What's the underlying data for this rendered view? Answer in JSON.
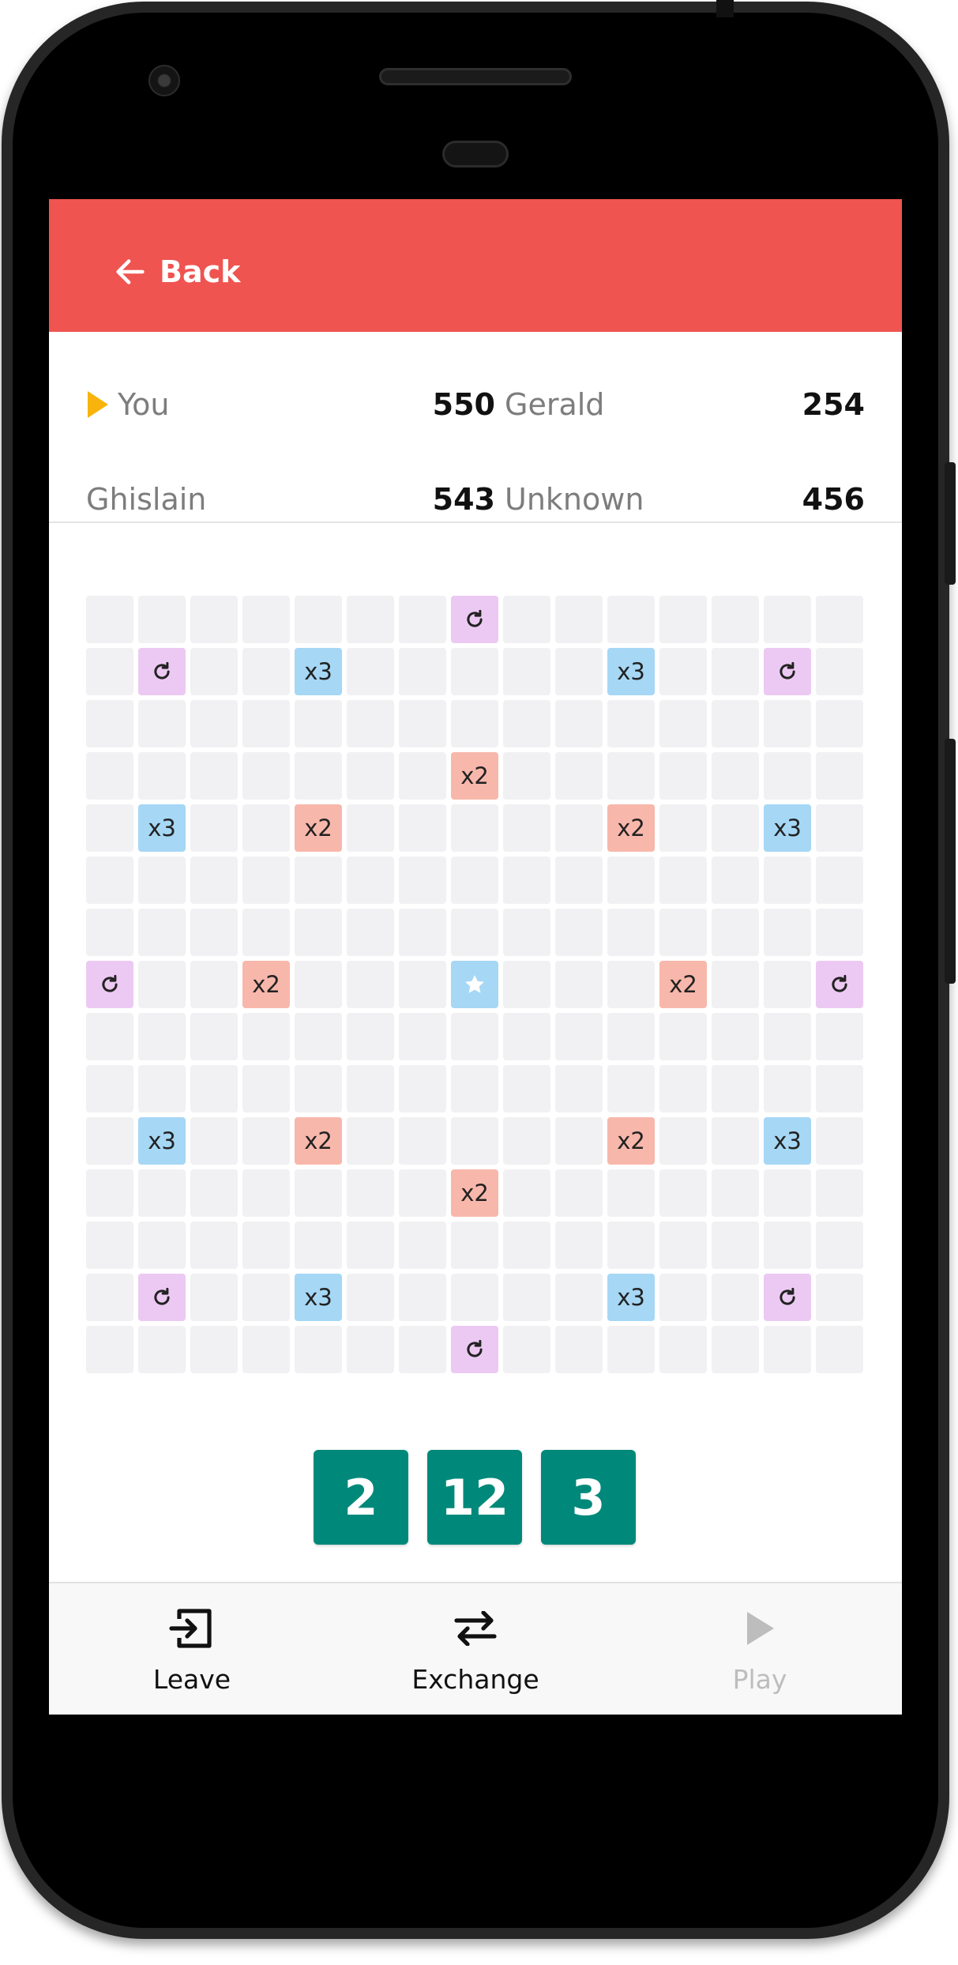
{
  "header": {
    "back_label": "Back"
  },
  "players": [
    {
      "name": "You",
      "score": "550",
      "current_turn": true
    },
    {
      "name": "Gerald",
      "score": "254",
      "current_turn": false
    },
    {
      "name": "Ghislain",
      "score": "543",
      "current_turn": false
    },
    {
      "name": "Unknown",
      "score": "456",
      "current_turn": false
    }
  ],
  "board": {
    "size": 15,
    "special_cells": [
      {
        "row": 0,
        "col": 7,
        "type": "refresh"
      },
      {
        "row": 1,
        "col": 1,
        "type": "refresh"
      },
      {
        "row": 1,
        "col": 4,
        "type": "x3",
        "label": "x3"
      },
      {
        "row": 1,
        "col": 10,
        "type": "x3",
        "label": "x3"
      },
      {
        "row": 1,
        "col": 13,
        "type": "refresh"
      },
      {
        "row": 3,
        "col": 7,
        "type": "x2",
        "label": "x2"
      },
      {
        "row": 4,
        "col": 1,
        "type": "x3",
        "label": "x3"
      },
      {
        "row": 4,
        "col": 4,
        "type": "x2",
        "label": "x2"
      },
      {
        "row": 4,
        "col": 10,
        "type": "x2",
        "label": "x2"
      },
      {
        "row": 4,
        "col": 13,
        "type": "x3",
        "label": "x3"
      },
      {
        "row": 7,
        "col": 0,
        "type": "refresh"
      },
      {
        "row": 7,
        "col": 3,
        "type": "x2",
        "label": "x2"
      },
      {
        "row": 7,
        "col": 7,
        "type": "star"
      },
      {
        "row": 7,
        "col": 11,
        "type": "x2",
        "label": "x2"
      },
      {
        "row": 7,
        "col": 14,
        "type": "refresh"
      },
      {
        "row": 10,
        "col": 1,
        "type": "x3",
        "label": "x3"
      },
      {
        "row": 10,
        "col": 4,
        "type": "x2",
        "label": "x2"
      },
      {
        "row": 10,
        "col": 10,
        "type": "x2",
        "label": "x2"
      },
      {
        "row": 10,
        "col": 13,
        "type": "x3",
        "label": "x3"
      },
      {
        "row": 11,
        "col": 7,
        "type": "x2",
        "label": "x2"
      },
      {
        "row": 13,
        "col": 1,
        "type": "refresh"
      },
      {
        "row": 13,
        "col": 4,
        "type": "x3",
        "label": "x3"
      },
      {
        "row": 13,
        "col": 10,
        "type": "x3",
        "label": "x3"
      },
      {
        "row": 13,
        "col": 13,
        "type": "refresh"
      },
      {
        "row": 14,
        "col": 7,
        "type": "refresh"
      }
    ]
  },
  "rack": {
    "tiles": [
      "2",
      "12",
      "3"
    ]
  },
  "actions": {
    "leave": {
      "label": "Leave",
      "icon": "exit-icon"
    },
    "exchange": {
      "label": "Exchange",
      "icon": "swap-icon"
    },
    "play": {
      "label": "Play",
      "icon": "play-icon",
      "disabled": true
    }
  },
  "colors": {
    "header": "#ef5451",
    "tile": "#00897a",
    "x2": "#f8b7ab",
    "x3": "#a6d7f5",
    "refresh": "#ecc9f2",
    "empty_cell": "#f1f1f3",
    "turn_indicator": "#f8b40c"
  }
}
